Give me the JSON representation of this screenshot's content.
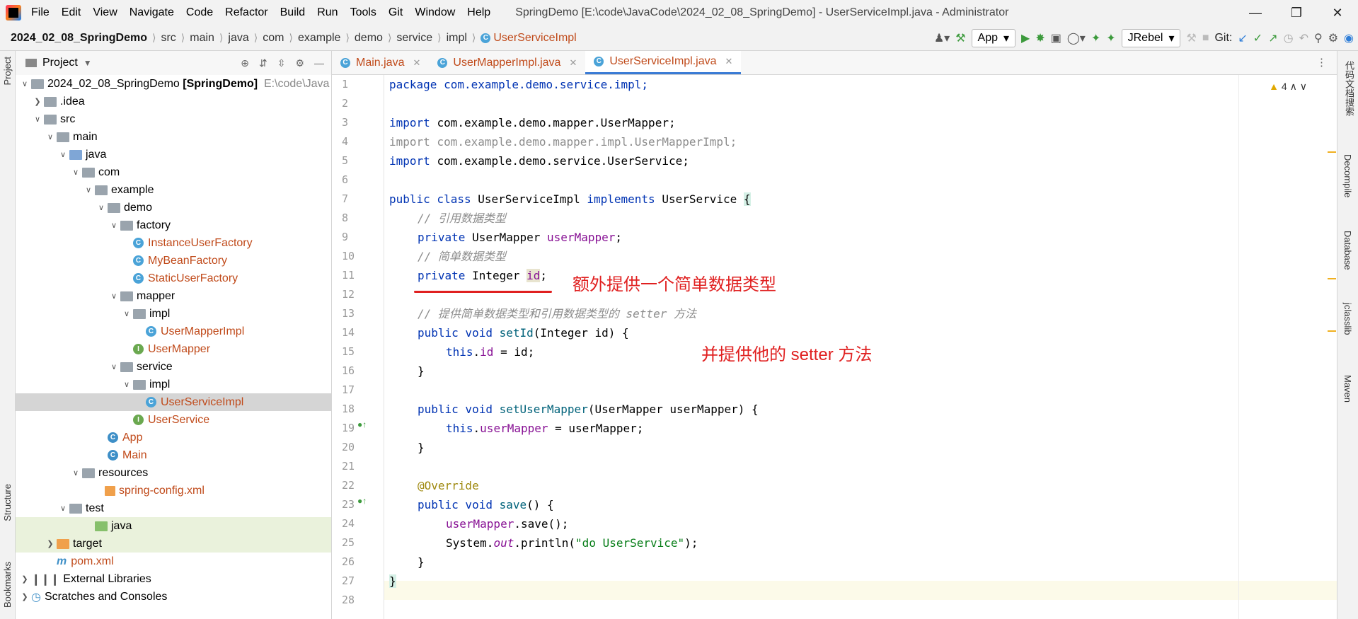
{
  "window": {
    "title": "SpringDemo [E:\\code\\JavaCode\\2024_02_08_SpringDemo] - UserServiceImpl.java - Administrator",
    "menu": [
      "File",
      "Edit",
      "View",
      "Navigate",
      "Code",
      "Refactor",
      "Build",
      "Run",
      "Tools",
      "Git",
      "Window",
      "Help"
    ]
  },
  "breadcrumb": [
    "2024_02_08_SpringDemo",
    "src",
    "main",
    "java",
    "com",
    "example",
    "demo",
    "service",
    "impl",
    "UserServiceImpl"
  ],
  "toolbar": {
    "run_config": "App",
    "jrebel": "JRebel",
    "git_label": "Git:"
  },
  "project_panel": {
    "title": "Project",
    "root_name": "2024_02_08_SpringDemo",
    "root_module": "[SpringDemo]",
    "root_path": "E:\\code\\Java",
    "items": [
      ".idea",
      "src",
      "main",
      "java",
      "com",
      "example",
      "demo",
      "factory",
      "InstanceUserFactory",
      "MyBeanFactory",
      "StaticUserFactory",
      "mapper",
      "impl",
      "UserMapperImpl",
      "UserMapper",
      "service",
      "impl",
      "UserServiceImpl",
      "UserService",
      "App",
      "Main",
      "resources",
      "spring-config.xml",
      "test",
      "java",
      "target",
      "pom.xml",
      "External Libraries",
      "Scratches and Consoles"
    ]
  },
  "tabs": [
    "Main.java",
    "UserMapperImpl.java",
    "UserServiceImpl.java"
  ],
  "editor": {
    "warning_count": "4",
    "line_numbers": [
      "1",
      "2",
      "3",
      "4",
      "5",
      "6",
      "7",
      "8",
      "9",
      "10",
      "11",
      "12",
      "13",
      "14",
      "15",
      "16",
      "17",
      "18",
      "19",
      "20",
      "21",
      "22",
      "23",
      "24",
      "25",
      "26",
      "27",
      "28"
    ],
    "code": {
      "l1": "package com.example.demo.service.impl;",
      "l3a": "import ",
      "l3b": "com.example.demo.mapper.UserMapper;",
      "l4": "import com.example.demo.mapper.impl.UserMapperImpl;",
      "l5a": "import ",
      "l5b": "com.example.demo.service.UserService;",
      "l7a": "public class ",
      "l7b": "UserServiceImpl ",
      "l7c": "implements ",
      "l7d": "UserService ",
      "l7e": "{",
      "l8": "// 引用数据类型",
      "l9a": "private ",
      "l9b": "UserMapper ",
      "l9c": "userMapper",
      ";": ";",
      "l10": "// 简单数据类型",
      "l11a": "private ",
      "l11b": "Integer ",
      "l11c": "id",
      "l13": "// 提供简单数据类型和引用数据类型的 setter 方法",
      "l14a": "public void ",
      "l14b": "setId",
      "l14c": "(Integer id) {",
      "l15a": "this",
      ".": ".",
      "l15b": "id",
      " = id;": " = id;",
      "rb": "}",
      "l18a": "public void ",
      "l18b": "setUserMapper",
      "l18c": "(UserMapper userMapper) {",
      "l19a": "this",
      "l19b": "userMapper",
      "l19c": " = userMapper;",
      "l22": "@Override",
      "l23a": "public void ",
      "l23b": "save",
      "l23c": "() {",
      "l24a": "userMapper",
      "l24b": ".save();",
      "l25a": "System.",
      "l25b": "out",
      "l25c": ".println(",
      "l25d": "\"do UserService\"",
      "l25e": ");"
    }
  },
  "annotations": {
    "a1": "额外提供一个简单数据类型",
    "a2": "并提供他的 setter 方法"
  },
  "left_stripe": [
    "Project",
    "Structure",
    "Bookmarks"
  ],
  "right_stripe": [
    "代码文档搜索",
    "Decompile",
    "Database",
    "jclasslib",
    "Maven"
  ]
}
